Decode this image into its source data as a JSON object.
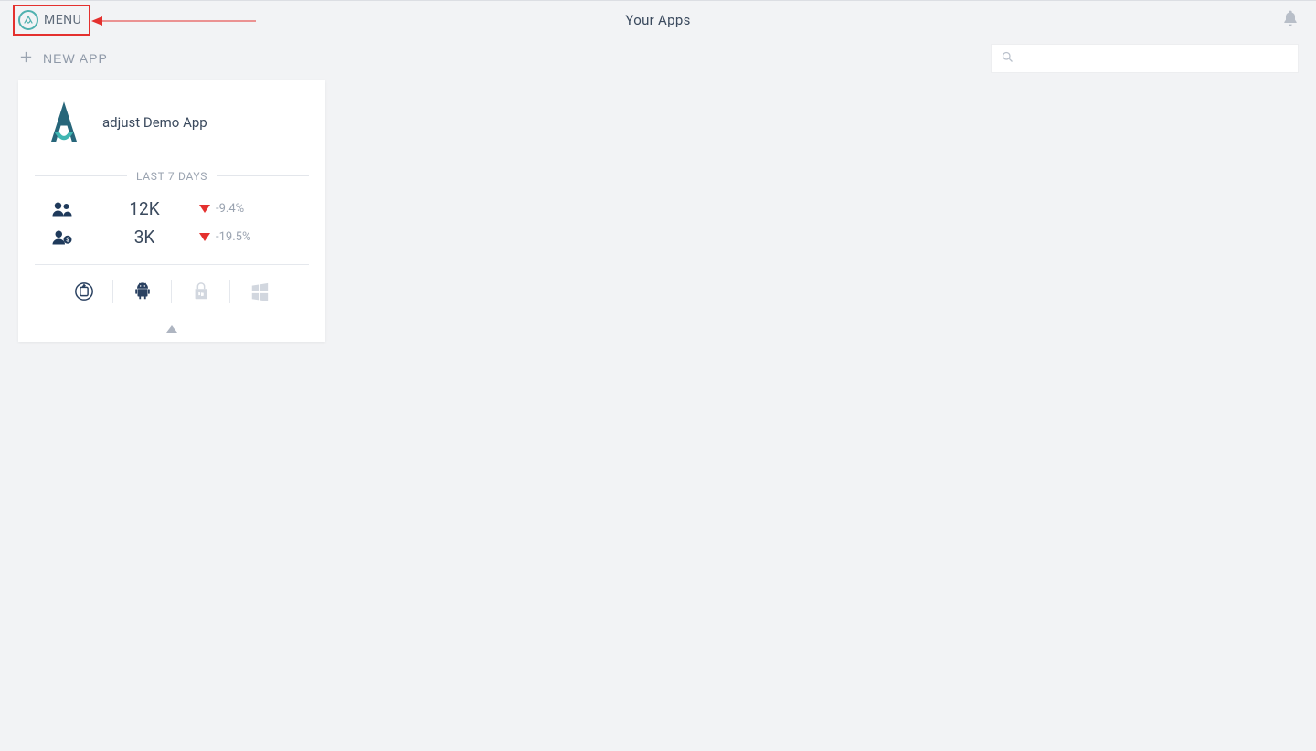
{
  "header": {
    "menu_label": "MENU",
    "page_title": "Your Apps"
  },
  "toolbar": {
    "new_app_label": "NEW APP",
    "search_placeholder": ""
  },
  "app_card": {
    "name": "adjust Demo App",
    "period_label": "LAST 7 DAYS",
    "stats": {
      "users": {
        "value": "12K",
        "delta": "-9.4%"
      },
      "paying_users": {
        "value": "3K",
        "delta": "-19.5%"
      }
    },
    "platforms": {
      "ios": true,
      "android": true,
      "windows_store": false,
      "windows": false
    }
  },
  "colors": {
    "accent_teal": "#50b1af",
    "annotation_red": "#e4302e",
    "text_primary": "#3b4a5e",
    "text_muted": "#9aa3b0",
    "bg": "#f2f3f5"
  }
}
